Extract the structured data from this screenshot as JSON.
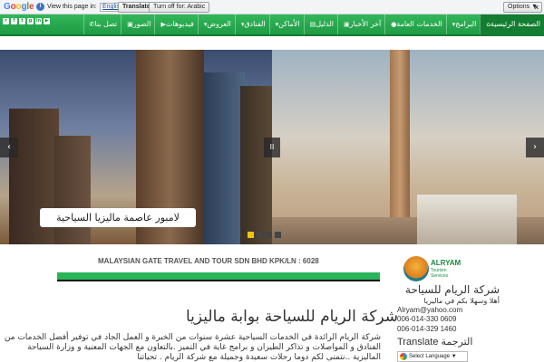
{
  "translate_bar": {
    "logo": "Google",
    "view_text": "View this page in:",
    "language": "English",
    "translate_label": "Translate",
    "turn_off_label": "Turn off for: Arabic",
    "options_label": "Options ▼",
    "close_label": "×"
  },
  "nav": {
    "items": [
      {
        "label": "الصفحة الرئيسية",
        "icon": "home-icon",
        "glyph": "⌂"
      },
      {
        "label": "البرامج",
        "icon": "menu-icon",
        "glyph": "▾"
      },
      {
        "label": "الخدمات العامة",
        "icon": "info-icon",
        "glyph": "●"
      },
      {
        "label": "آخر الأخبار",
        "icon": "news-icon",
        "glyph": "▣"
      },
      {
        "label": "الدليل",
        "icon": "guide-icon",
        "glyph": "▤"
      },
      {
        "label": "الأماكن",
        "icon": "places-icon",
        "glyph": "▾"
      },
      {
        "label": "الفنادق",
        "icon": "hotel-icon",
        "glyph": "▾"
      },
      {
        "label": "العروض",
        "icon": "offers-icon",
        "glyph": "▾"
      },
      {
        "label": "فيديوهات",
        "icon": "video-icon",
        "glyph": "▶"
      },
      {
        "label": "الصور",
        "icon": "photo-icon",
        "glyph": "▣"
      },
      {
        "label": "تصل بنا",
        "icon": "contact-icon",
        "glyph": "✆"
      }
    ]
  },
  "slider": {
    "caption": "لامبور عاصمة ماليزيا السياحية",
    "prev_label": "‹",
    "next_label": "›",
    "pause_label": "II",
    "slide_count": 4,
    "active_index": 0
  },
  "content": {
    "company_title": "MALAYSIAN GATE TRAVEL AND TOUR SDN BHD KPK/LN : 6028",
    "heading": "شركة الريام للسياحة بوابة ماليزيا",
    "description": "شركة الريام الرائدة في الخدمات السياحية عشرة سنوات من الخبرة و العمل الجاد في توفير أفضل الخدمات من الفنادق و المواصلات و تذاكر الطيران و برامج غاية في التميز .بالتعاون مع الجهات المعنية و وزارة السياحة الماليزية ..نتمنى لكم دوما رحلات سعيدة وجميلة مع شركة الريام . تحياتنا"
  },
  "sidebar": {
    "logo_name": "ALRYAM",
    "logo_sub": "Tourism Services",
    "title": "شركة الريام للسياحة",
    "greeting": "أهلا وسهلا بكم في ماليزيا",
    "email": "Alryam@yahoo.com",
    "phone1": "006-014-330 0609",
    "phone2": "006-014-329 1460",
    "translate_title": "Translate الترجمة",
    "select_label": "Select Language ▼"
  }
}
